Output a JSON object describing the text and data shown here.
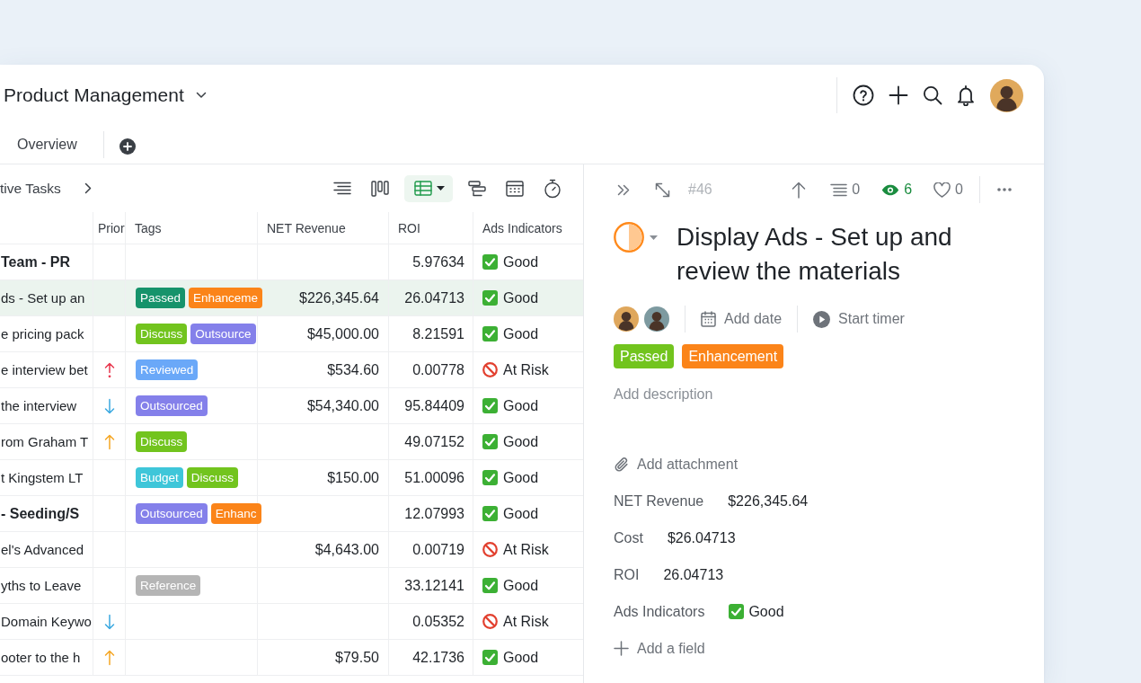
{
  "header": {
    "title": "Product Management"
  },
  "tabs": [
    {
      "label": "Overview",
      "selected": false
    }
  ],
  "list_toolbar": {
    "breadcrumb": "tive Tasks",
    "views": [
      {
        "kind": "list",
        "selected": false
      },
      {
        "kind": "board",
        "selected": false
      },
      {
        "kind": "table",
        "selected": true
      },
      {
        "kind": "gantt",
        "selected": false
      },
      {
        "kind": "calendar",
        "selected": false
      },
      {
        "kind": "timer",
        "selected": false
      }
    ]
  },
  "table": {
    "columns": [
      "Prior",
      "Tags",
      "NET Revenue",
      "ROI",
      "Ads Indicators"
    ],
    "rows": [
      {
        "kind": "group",
        "name": "Team - PR",
        "selected": false,
        "roi": "5.97634",
        "ads_indicator": {
          "kind": "good",
          "label": "Good"
        }
      },
      {
        "kind": "task",
        "name": "ds - Set up an",
        "selected": true,
        "tags": [
          {
            "label": "Passed",
            "color": "#16936b"
          },
          {
            "label": "Enhanceme",
            "color": "#fb8419"
          }
        ],
        "net_revenue": "$226,345.64",
        "roi": "26.04713",
        "ads_indicator": {
          "kind": "good",
          "label": "Good"
        }
      },
      {
        "kind": "task",
        "name": "e pricing pack",
        "selected": false,
        "tags": [
          {
            "label": "Discuss",
            "color": "#72c41e"
          },
          {
            "label": "Outsource",
            "color": "#8480ea"
          }
        ],
        "net_revenue": "$45,000.00",
        "roi": "8.21591",
        "ads_indicator": {
          "kind": "good",
          "label": "Good"
        }
      },
      {
        "kind": "task",
        "name": "e interview bet",
        "selected": false,
        "priority": {
          "kind": "urgent"
        },
        "tags": [
          {
            "label": "Reviewed",
            "color": "#6aa8f8"
          }
        ],
        "net_revenue": "$534.60",
        "roi": "0.00778",
        "ads_indicator": {
          "kind": "risk",
          "label": "At Risk"
        }
      },
      {
        "kind": "task",
        "name": "the interview",
        "selected": false,
        "priority": {
          "kind": "low"
        },
        "tags": [
          {
            "label": "Outsourced",
            "color": "#8480ea"
          }
        ],
        "net_revenue": "$54,340.00",
        "roi": "95.84409",
        "ads_indicator": {
          "kind": "good",
          "label": "Good"
        }
      },
      {
        "kind": "task",
        "name": "rom Graham T",
        "selected": false,
        "priority": {
          "kind": "high"
        },
        "tags": [
          {
            "label": "Discuss",
            "color": "#72c41e"
          }
        ],
        "roi": "49.07152",
        "ads_indicator": {
          "kind": "good",
          "label": "Good"
        }
      },
      {
        "kind": "task",
        "name": "t Kingstem LT",
        "selected": false,
        "tags": [
          {
            "label": "Budget",
            "color": "#3ec6d9"
          },
          {
            "label": "Discuss",
            "color": "#72c41e"
          }
        ],
        "net_revenue": "$150.00",
        "roi": "51.00096",
        "ads_indicator": {
          "kind": "good",
          "label": "Good"
        }
      },
      {
        "kind": "group",
        "name": "- Seeding/S",
        "selected": false,
        "tags": [
          {
            "label": "Outsourced",
            "color": "#8480ea"
          },
          {
            "label": "Enhanc",
            "color": "#fb8419"
          }
        ],
        "roi": "12.07993",
        "ads_indicator": {
          "kind": "good",
          "label": "Good"
        }
      },
      {
        "kind": "task",
        "name": "el's Advanced",
        "selected": false,
        "net_revenue": "$4,643.00",
        "roi": "0.00719",
        "ads_indicator": {
          "kind": "risk",
          "label": "At Risk"
        }
      },
      {
        "kind": "task",
        "name": "yths to Leave",
        "selected": false,
        "tags": [
          {
            "label": "Reference",
            "color": "#b5b5b5"
          }
        ],
        "roi": "33.12141",
        "ads_indicator": {
          "kind": "good",
          "label": "Good"
        }
      },
      {
        "kind": "task",
        "name": "Domain Keywo",
        "selected": false,
        "priority": {
          "kind": "low"
        },
        "roi": "0.05352",
        "ads_indicator": {
          "kind": "risk",
          "label": "At Risk"
        }
      },
      {
        "kind": "task",
        "name": "ooter to the h",
        "selected": false,
        "priority": {
          "kind": "high"
        },
        "net_revenue": "$79.50",
        "roi": "42.1736",
        "ads_indicator": {
          "kind": "good",
          "label": "Good"
        }
      }
    ]
  },
  "detail": {
    "number": "#46",
    "counters": [
      {
        "kind": "subtasks",
        "value": "0",
        "active": false
      },
      {
        "kind": "watchers",
        "value": "6",
        "active": true
      },
      {
        "kind": "likes",
        "value": "0",
        "active": false
      }
    ],
    "status": {
      "kind": "in_progress"
    },
    "title": "Display Ads - Set up and review the materials",
    "assignees": [
      {
        "color": "#dfa75c"
      },
      {
        "color": "#7d9aa0"
      }
    ],
    "date_action": "Add date",
    "timer_action": "Start timer",
    "tags": [
      {
        "label": "Passed",
        "color": "#72c41e"
      },
      {
        "label": "Enhancement",
        "color": "#fb8419"
      }
    ],
    "description": {
      "placeholder": "Add description"
    },
    "attachment_action": "Add attachment",
    "fields": [
      {
        "kind": "plain",
        "label": "NET Revenue",
        "value": "$226,345.64"
      },
      {
        "kind": "plain",
        "label": "Cost",
        "value": "$26.04713"
      },
      {
        "kind": "plain",
        "label": "ROI",
        "value": "26.04713"
      },
      {
        "kind": "good",
        "label": "Ads Indicators",
        "value": "Good"
      }
    ],
    "add_field_action": "Add a field"
  }
}
